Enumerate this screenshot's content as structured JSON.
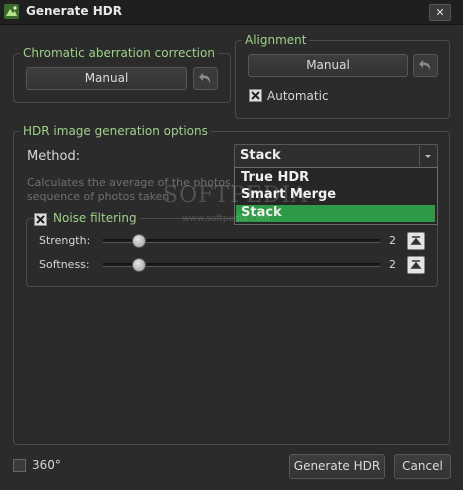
{
  "window": {
    "title": "Generate HDR",
    "close_label": "✕"
  },
  "chromatic": {
    "legend": "Chromatic aberration correction",
    "button_label": "Manual"
  },
  "alignment": {
    "legend": "Alignment",
    "button_label": "Manual",
    "automatic_label": "Automatic",
    "automatic_checked": true
  },
  "hdr": {
    "legend": "HDR image generation options",
    "method_label": "Method:",
    "method_value": "Stack",
    "method_options": [
      "True HDR",
      "Smart Merge",
      "Stack"
    ],
    "description_line1": "Calculates the average of the photos. Gr",
    "description_line2": "sequence of photos taken",
    "noise_legend": "Noise filtering",
    "noise_checked": true,
    "strength_label": "Strength:",
    "strength_value": "2",
    "softness_label": "Softness:",
    "softness_value": "2"
  },
  "footer": {
    "pano_label": "360°",
    "pano_checked": false,
    "generate_label": "Generate HDR",
    "cancel_label": "Cancel"
  },
  "watermark": {
    "text": "SOFTPEDIA",
    "url": "www.softpedia.com"
  },
  "colors": {
    "accent": "#9fd18a",
    "selection": "#2e9a45",
    "background": "#2b2b2b"
  }
}
